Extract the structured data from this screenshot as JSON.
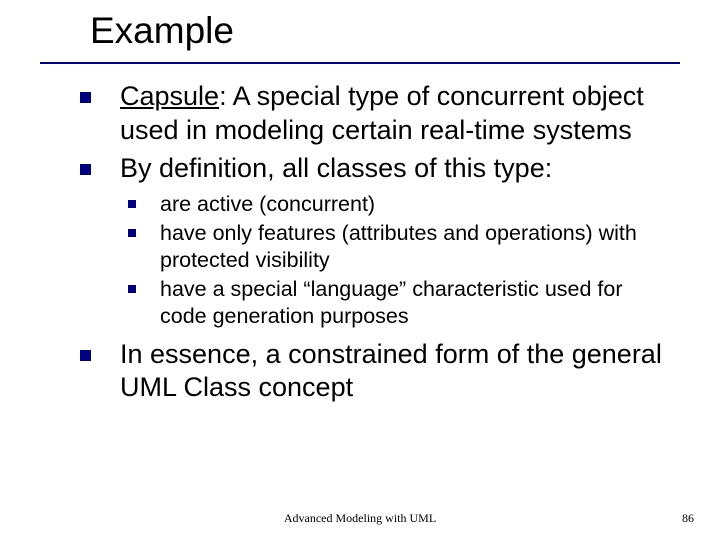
{
  "title": "Example",
  "items": [
    {
      "prefix": "Capsule",
      "rest": ": A special type of concurrent object used in modeling certain real-time systems"
    },
    {
      "text": "By definition, all classes of this type:",
      "sub": [
        "are active (concurrent)",
        "have only features (attributes and operations) with protected visibility",
        "have a special “language” characteristic used for code generation purposes"
      ]
    },
    {
      "text": "In essence, a constrained form of the general UML Class concept"
    }
  ],
  "footer": {
    "center": "Advanced Modeling with UML",
    "pageNumber": "86"
  }
}
